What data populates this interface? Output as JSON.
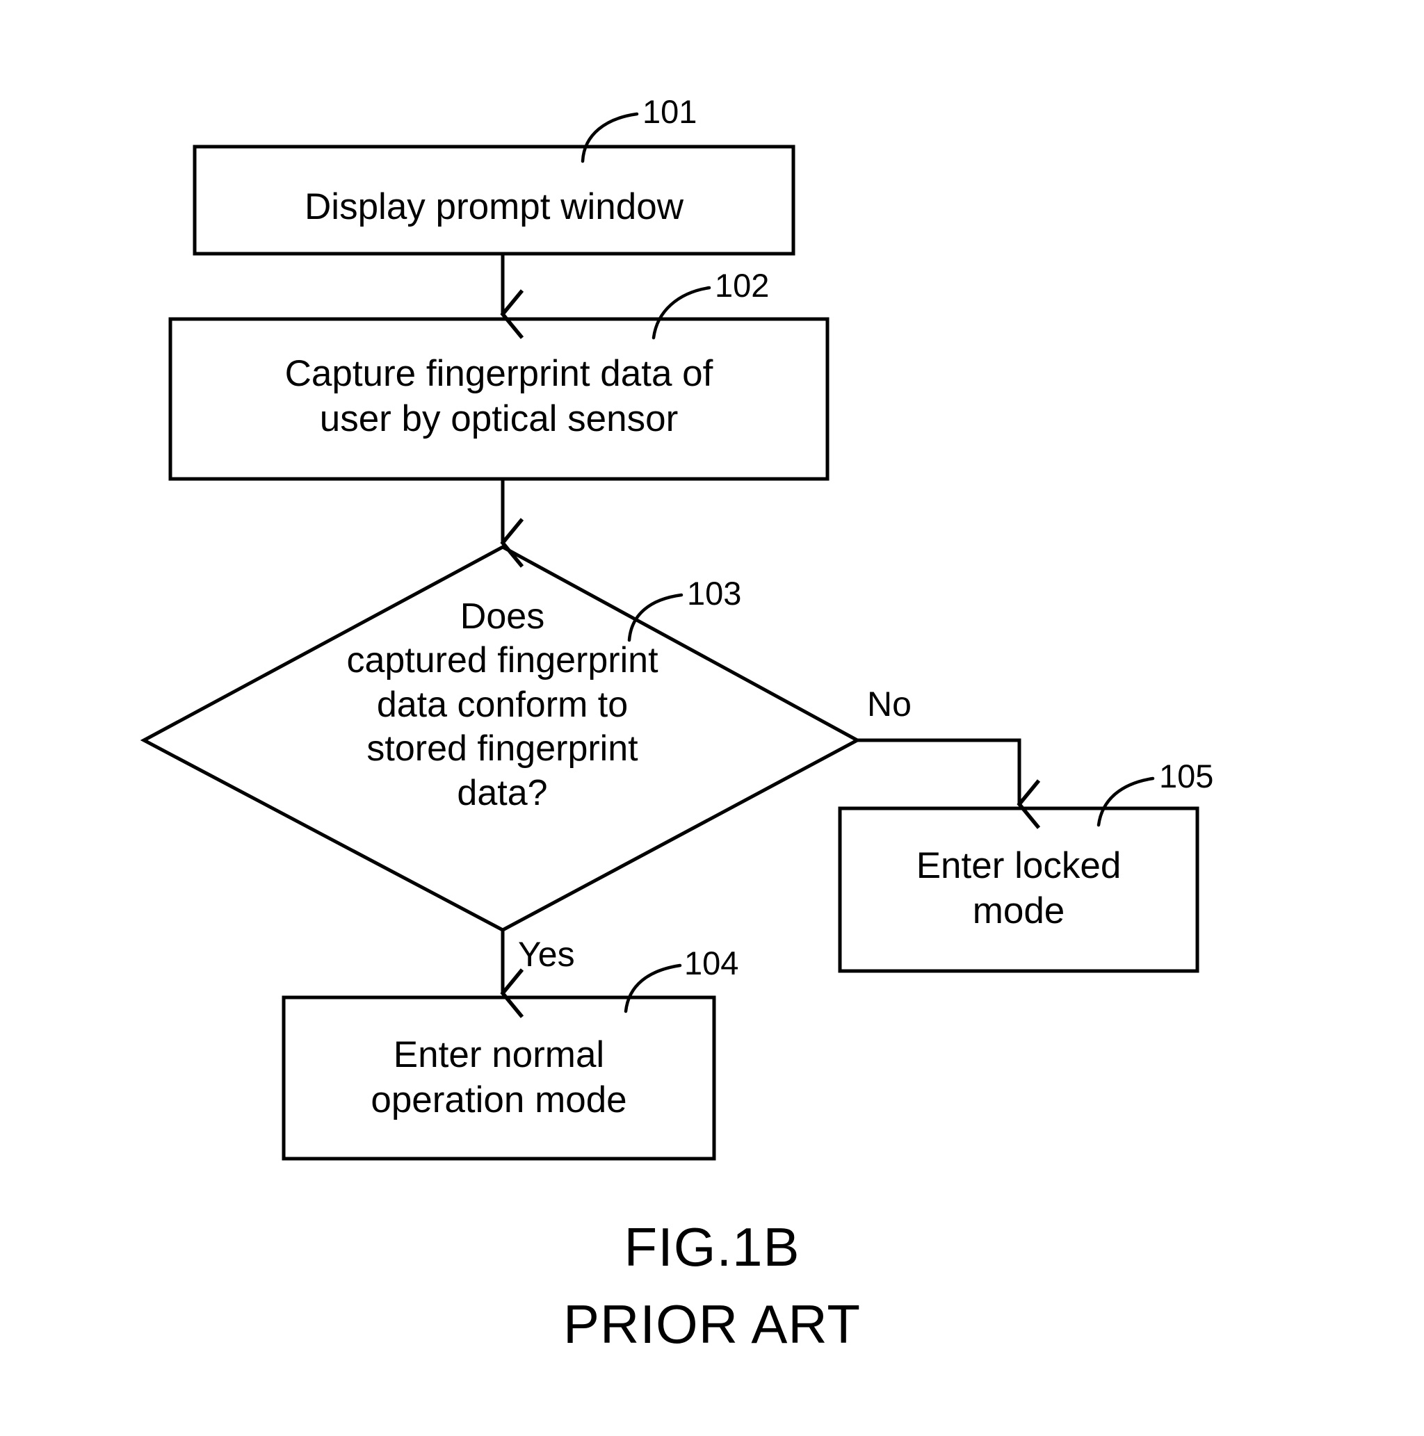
{
  "figure": {
    "caption_main": "FIG.1B",
    "caption_sub": "PRIOR ART"
  },
  "chart_data": {
    "type": "diagram",
    "diagram_kind": "flowchart",
    "title": "FIG.1B",
    "subtitle": "PRIOR ART",
    "nodes": [
      {
        "ref": "101",
        "shape": "process",
        "text": "Display prompt window"
      },
      {
        "ref": "102",
        "shape": "process",
        "text": "Capture fingerprint data of user by optical sensor"
      },
      {
        "ref": "103",
        "shape": "decision",
        "text": "Does captured fingerprint data conform to stored fingerprint data?"
      },
      {
        "ref": "104",
        "shape": "process",
        "text": "Enter normal operation mode"
      },
      {
        "ref": "105",
        "shape": "process",
        "text": "Enter locked mode"
      }
    ],
    "edges": [
      {
        "from": "101",
        "to": "102",
        "label": ""
      },
      {
        "from": "102",
        "to": "103",
        "label": ""
      },
      {
        "from": "103",
        "to": "104",
        "label": "Yes"
      },
      {
        "from": "103",
        "to": "105",
        "label": "No"
      }
    ]
  },
  "nodes": {
    "n101": {
      "ref": "101",
      "line1": "Display prompt window",
      "text": "Display prompt window"
    },
    "n102": {
      "ref": "102",
      "line1": "Capture fingerprint data of",
      "line2": "user by optical sensor",
      "text": "Capture fingerprint data of\nuser by optical sensor"
    },
    "n103": {
      "ref": "103",
      "line1": "Does",
      "line2": "captured fingerprint",
      "line3": "data conform to",
      "line4": "stored fingerprint",
      "line5": "data?",
      "text": "Does\ncaptured fingerprint\ndata conform to\nstored fingerprint\ndata?"
    },
    "n104": {
      "ref": "104",
      "line1": "Enter normal",
      "line2": "operation mode",
      "text": "Enter normal\noperation mode"
    },
    "n105": {
      "ref": "105",
      "line1": "Enter locked",
      "line2": "mode",
      "text": "Enter locked\nmode"
    }
  },
  "branch_labels": {
    "yes": "Yes",
    "no": "No"
  },
  "colors": {
    "stroke": "#000000",
    "background": "#ffffff",
    "text": "#000000"
  }
}
